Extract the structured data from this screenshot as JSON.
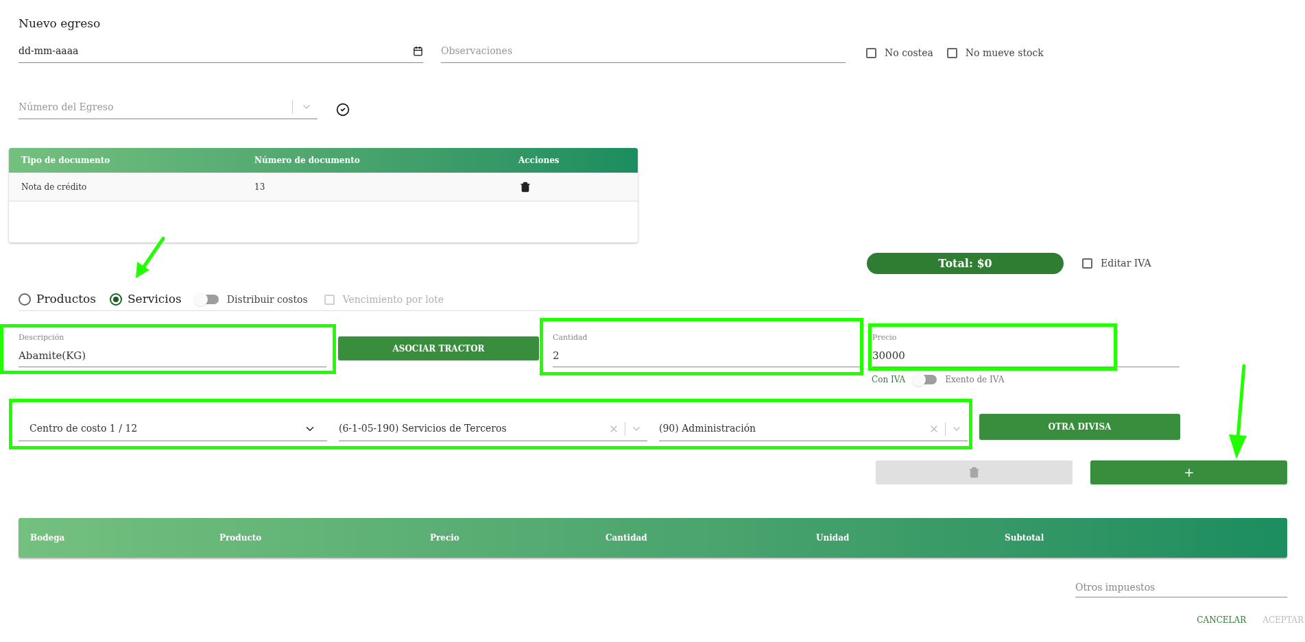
{
  "title": "Nuevo egreso",
  "date_field": {
    "value": "dd-mm-aaaa"
  },
  "observaciones_field": {
    "placeholder": "Observaciones"
  },
  "options": [
    {
      "label": "No costea",
      "checked": false
    },
    {
      "label": "No mueve stock",
      "checked": false
    }
  ],
  "numero_select": {
    "placeholder": "Número del Egreso"
  },
  "documents_table": {
    "columns": [
      "Tipo de documento",
      "Número de documento",
      "Acciones"
    ],
    "rows": [
      [
        "Nota de crédito",
        "13"
      ]
    ]
  },
  "total": "Total: $0",
  "editar_iva": {
    "label": "Editar IVA",
    "checked": false
  },
  "item_type": [
    {
      "label": "Productos",
      "selected": false
    },
    {
      "label": "Servicios",
      "selected": true
    }
  ],
  "distribuir_costos": {
    "label": "Distribuir costos",
    "on": false
  },
  "vencimiento_por_lote": {
    "label": "Vencimiento por lote",
    "checked": false,
    "disabled": true
  },
  "descripcion": {
    "label": "Descripción",
    "value": "Abamite(KG)"
  },
  "asociar_button": "ASOCIAR TRACTOR",
  "cantidad": {
    "label": "Cantidad",
    "value": "2"
  },
  "precio": {
    "label": "Precio",
    "value": "30000"
  },
  "iva_toggle": {
    "left_label": "Con IVA",
    "right_label": "Exento de IVA",
    "on": false
  },
  "selects": [
    {
      "value": "Centro de costo 1 / 12",
      "clearable": false
    },
    {
      "value": "(6-1-05-190) Servicios de Terceros",
      "clearable": true
    },
    {
      "value": "(90) Administración",
      "clearable": true
    }
  ],
  "otra_divisa_button": "OTRA DIVISA",
  "delete_button": {
    "disabled": true
  },
  "items_table": {
    "columns": [
      "Bodega",
      "Producto",
      "Precio",
      "Cantidad",
      "Unidad",
      "Subtotal"
    ]
  },
  "otros_impuestos": {
    "placeholder": "Otros impuestos"
  },
  "actions": [
    {
      "label": "CANCELAR",
      "disabled": false
    },
    {
      "label": "ACEPTAR",
      "disabled": true
    }
  ]
}
